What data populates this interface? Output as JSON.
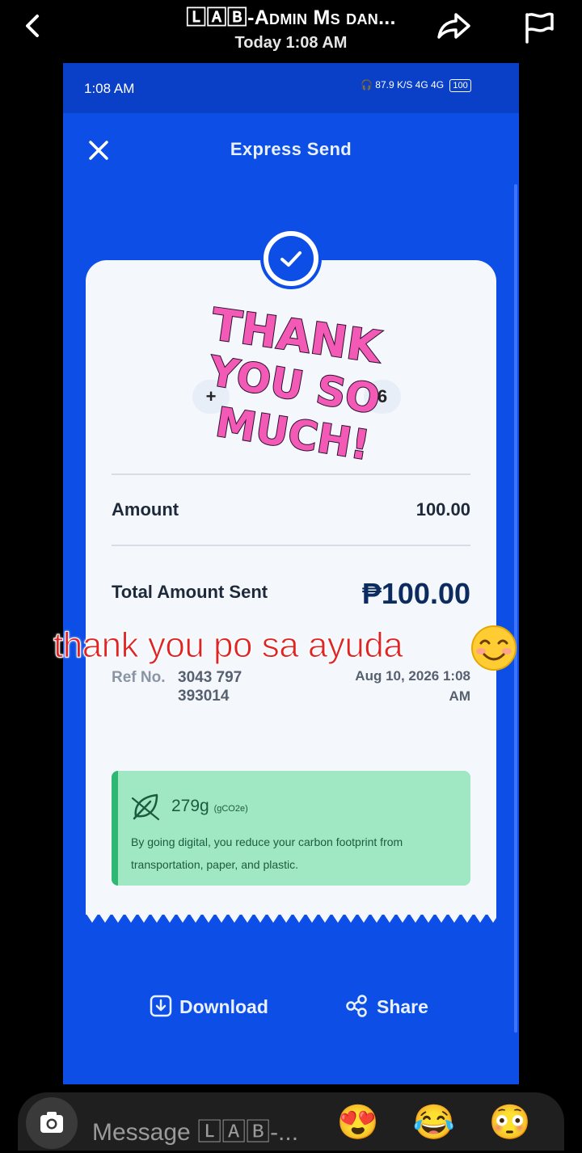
{
  "header": {
    "title": "🄻🄰🄱-Admin Ms dan...",
    "subtitle": "Today 1:08 AM"
  },
  "phone": {
    "status_time": "1:08 AM",
    "status_speed": "87.9 K/S",
    "status_network": "4G  4G",
    "battery": "100",
    "screen_title": "Express Send"
  },
  "receipt": {
    "amount_label": "Amount",
    "amount_value": "100.00",
    "total_label": "Total Amount Sent",
    "total_value": "₱100.00",
    "ref_label": "Ref No.",
    "ref_line1": "3043 797",
    "ref_line2": "393014",
    "date_line1": "Aug 10, 2026 1:08",
    "date_line2": "AM",
    "carbon_amount": "279g",
    "carbon_unit": "(gCO2e)",
    "carbon_text": "By going digital, you reduce your carbon footprint from transportation, paper, and plastic."
  },
  "sticker": {
    "line1": "THANK",
    "line2": "YOU SO",
    "line3": "MUCH!"
  },
  "actions": {
    "download_label": "Download",
    "share_label": "Share"
  },
  "caption": "thank you po sa ayuda",
  "composer": {
    "placeholder": "Message 🄻🄰🄱-..."
  },
  "colors": {
    "brand_blue": "#0d4fe6",
    "caption_red": "#e02424",
    "carbon_green": "#a0e8c4"
  },
  "icons": [
    "back-icon",
    "forward-icon",
    "flag-icon",
    "close-icon",
    "check-icon",
    "leaf-icon",
    "download-icon",
    "share-icon",
    "camera-icon"
  ],
  "reactions": [
    "😍",
    "😂",
    "😳"
  ]
}
